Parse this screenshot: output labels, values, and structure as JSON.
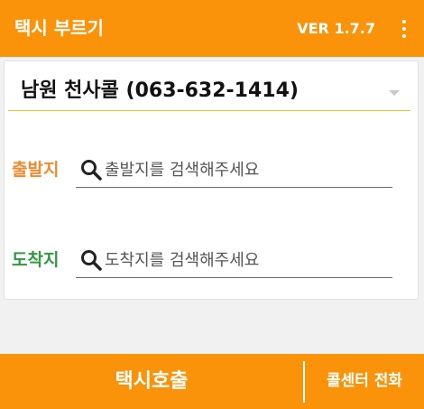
{
  "app_bar": {
    "title": "택시 부르기",
    "version": "VER 1.7.7",
    "menu_icon": "more-vertical-icon"
  },
  "company_select": {
    "selected": "남원 천사콜 (063-632-1414)",
    "arrow_icon": "dropdown-arrow-icon"
  },
  "origin": {
    "label": "출발지",
    "placeholder": "출발지를 검색해주세요",
    "value": "",
    "icon": "search-icon"
  },
  "destination": {
    "label": "도착지",
    "placeholder": "도착지를 검색해주세요",
    "value": "",
    "icon": "search-icon"
  },
  "bottom_bar": {
    "call_taxi_label": "택시호출",
    "call_center_label": "콜센터 전화"
  },
  "colors": {
    "accent": "#fb930a",
    "origin_label": "#ef8a2e",
    "destination_label": "#2e9b40",
    "select_underline": "#f0c030"
  }
}
